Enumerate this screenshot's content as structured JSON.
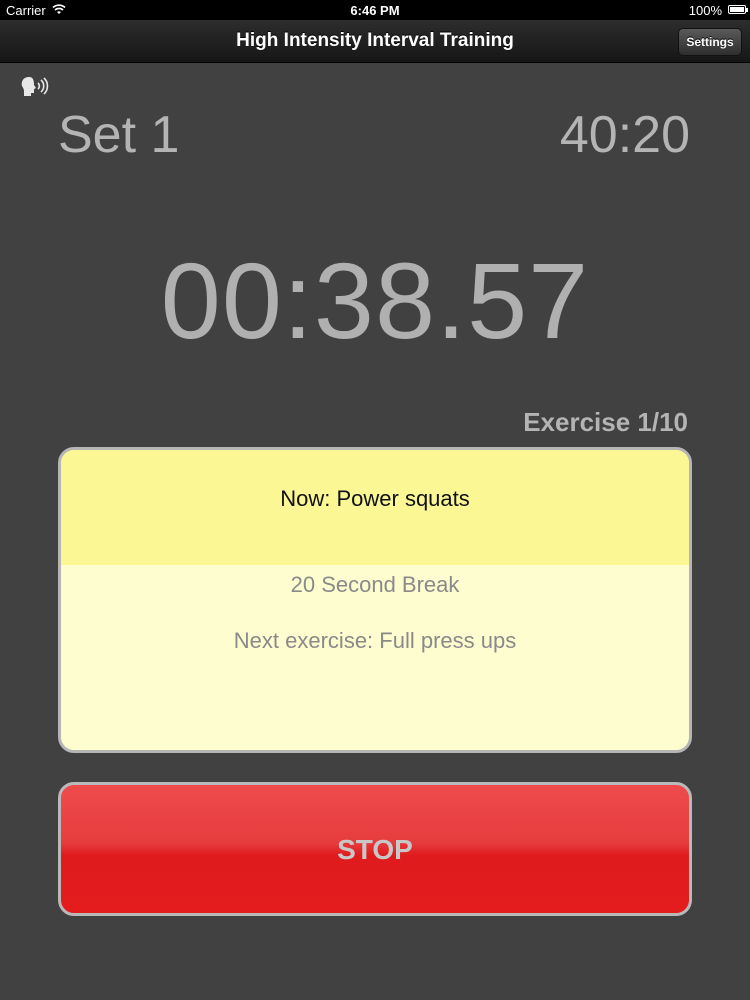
{
  "status_bar": {
    "carrier": "Carrier",
    "time": "6:46 PM",
    "battery": "100%"
  },
  "nav": {
    "title": "High Intensity Interval Training",
    "settings_label": "Settings"
  },
  "workout": {
    "set_label": "Set 1",
    "total_time": "40:20",
    "timer": "00:38.57",
    "exercise_counter": "Exercise 1/10"
  },
  "card": {
    "now": "Now: Power squats",
    "break": "20 Second Break",
    "next": "Next exercise: Full press ups"
  },
  "stop_label": "STOP",
  "colors": {
    "background": "#414141",
    "now_band": "#fcf795",
    "card_body": "#fefdd0",
    "stop_red": "#e41c1e"
  },
  "icons": {
    "speech": "speaking-head-icon"
  }
}
